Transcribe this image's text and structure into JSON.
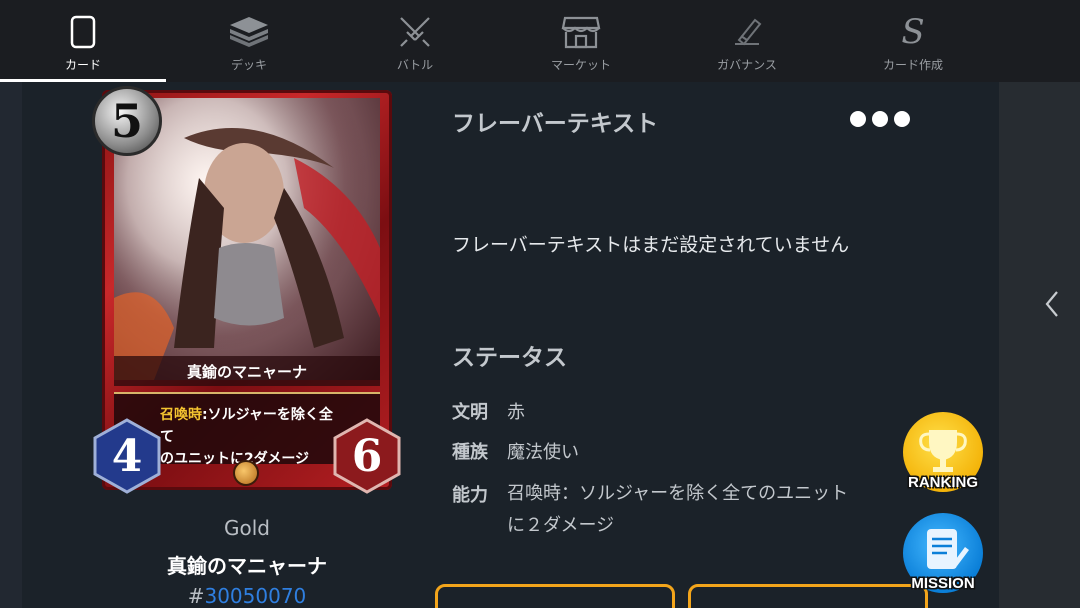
{
  "nav": {
    "tabs": [
      {
        "label": "カード",
        "icon": "card-icon",
        "active": true
      },
      {
        "label": "デッキ",
        "icon": "deck-icon",
        "active": false
      },
      {
        "label": "バトル",
        "icon": "battle-icon",
        "active": false
      },
      {
        "label": "マーケット",
        "icon": "market-icon",
        "active": false
      },
      {
        "label": "ガバナンス",
        "icon": "governance-icon",
        "active": false
      },
      {
        "label": "カード作成",
        "icon": "card-create-icon",
        "active": false
      }
    ]
  },
  "card": {
    "cost": "5",
    "power": "4",
    "toughness": "6",
    "art_name": "真鍮のマニャーナ",
    "art_keyword": "召喚時",
    "art_text_1": ":ソルジャーを除く全て",
    "art_text_2": "のユニットに2ダメージ",
    "rarity": "Gold",
    "title": "真鍮のマニャーナ",
    "id_prefix": "#",
    "id_number": "30050070"
  },
  "details": {
    "flavor_heading": "フレーバーテキスト",
    "flavor_text": "フレーバーテキストはまだ設定されていません",
    "status_heading": "ステータス",
    "stats": {
      "civilization": {
        "label": "文明",
        "value": "赤"
      },
      "race": {
        "label": "種族",
        "value": "魔法使い"
      },
      "ability": {
        "label": "能力",
        "value_line1": "召喚時：ソルジャーを除く全てのユニット",
        "value_line2": "に２ダメージ"
      }
    }
  },
  "floating": {
    "ranking": "RANKING",
    "mission": "MISSION"
  },
  "colors": {
    "accent_orange": "#f3a51b",
    "id_link": "#2f7fe0",
    "ranking_gold": "#f4b40a",
    "mission_blue": "#0b7fd8"
  }
}
